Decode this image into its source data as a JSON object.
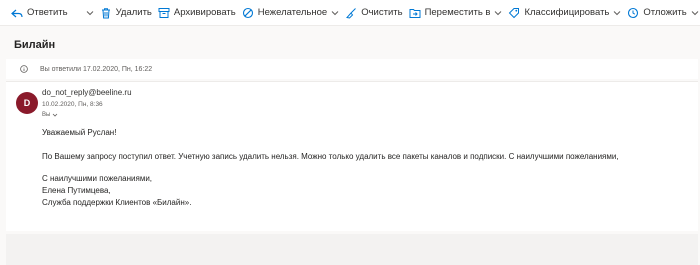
{
  "toolbar": {
    "reply_label": "Ответить",
    "delete_label": "Удалить",
    "archive_label": "Архивировать",
    "junk_label": "Нежелательное",
    "sweep_label": "Очистить",
    "move_label": "Переместить в",
    "categorize_label": "Классифицировать",
    "snooze_label": "Отложить",
    "more_label": "···"
  },
  "conversation": {
    "title": "Билайн",
    "replied_notice": "Вы ответили 17.02.2020, Пн, 16:22"
  },
  "message": {
    "avatar_letter": "D",
    "avatar_color": "#8a1a2b",
    "sender": "do_not_reply@beeline.ru",
    "date": "10.02.2020, Пн, 8:36",
    "to": "Вы",
    "body": {
      "greeting": "Уважаемый Руслан!",
      "paragraph": "По Вашему запросу поступил ответ. Учетную запись удалить нельзя. Можно только удалить все пакеты каналов и подписки. С наилучшими пожеланиями,",
      "closing": "С наилучшими пожеланиями,",
      "signature_name": "Елена Путимцева,",
      "signature_org": "Служба поддержки Клиентов «Билайн»."
    }
  },
  "colors": {
    "accent": "#0078d4",
    "background": "#faf9f8"
  }
}
